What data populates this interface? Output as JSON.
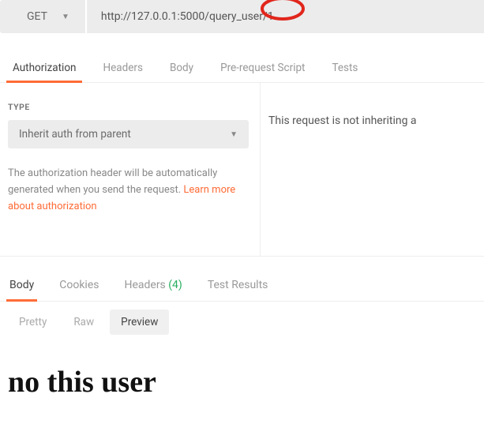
{
  "request": {
    "method": "GET",
    "url": "http://127.0.0.1:5000/query_user/1"
  },
  "topTabs": {
    "authorization": "Authorization",
    "headers": "Headers",
    "body": "Body",
    "prerequest": "Pre-request Script",
    "tests": "Tests"
  },
  "auth": {
    "typeLabel": "TYPE",
    "selected": "Inherit auth from parent",
    "helpPrefix": "The authorization header will be automatically generated when you send the request. ",
    "helpLink": "Learn more about authorization",
    "notInheriting": "This request is not inheriting a"
  },
  "respTabs": {
    "body": "Body",
    "cookies": "Cookies",
    "headersLabel": "Headers ",
    "headersCount": "(4)",
    "testResults": "Test Results"
  },
  "views": {
    "pretty": "Pretty",
    "raw": "Raw",
    "preview": "Preview"
  },
  "response": {
    "preview": "no this user"
  }
}
